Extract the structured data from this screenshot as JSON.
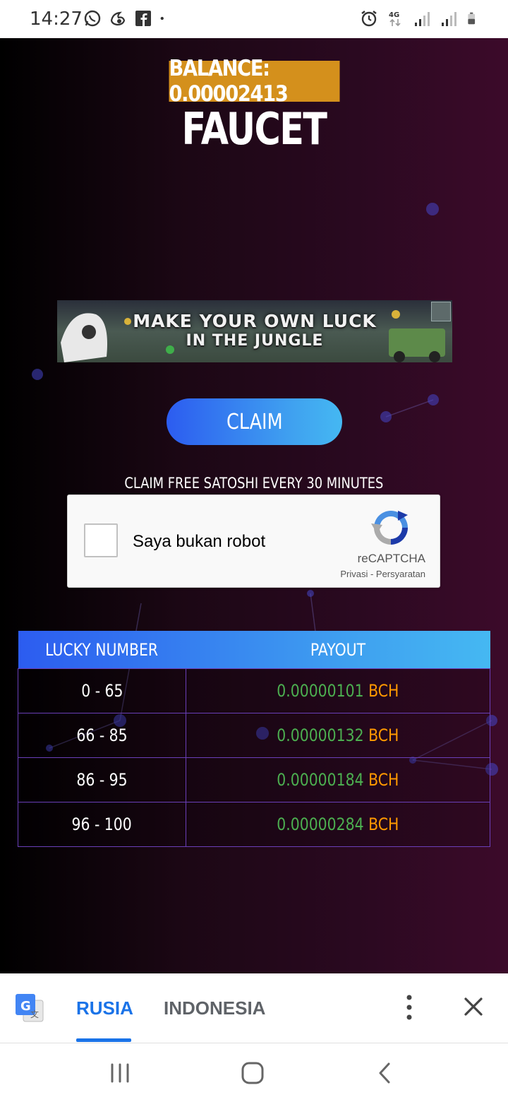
{
  "status_bar": {
    "time": "14:27",
    "left_icons": [
      "whatsapp-icon",
      "uc-browser-icon",
      "facebook-icon",
      "dot-icon"
    ],
    "right_icons": [
      "alarm-icon",
      "4g-icon",
      "signal-icon",
      "signal-icon-2",
      "battery-icon"
    ],
    "network": "4G"
  },
  "page": {
    "balance": "BALANCE: 0.00002413",
    "title": "FAUCET",
    "ad": {
      "line1": "MAKE YOUR OWN LUCK",
      "line2": "IN THE JUNGLE"
    },
    "claim_button": "CLAIM",
    "claim_note": "CLAIM FREE SATOSHI EVERY 30 MINUTES",
    "recaptcha": {
      "label": "Saya bukan robot",
      "brand": "reCAPTCHA",
      "links": "Privasi - Persyaratan"
    },
    "table": {
      "headers": [
        "LUCKY NUMBER",
        "PAYOUT"
      ],
      "rows": [
        {
          "range": "0 - 65",
          "amount": "0.00000101",
          "currency": "BCH"
        },
        {
          "range": "66 - 85",
          "amount": "0.00000132",
          "currency": "BCH"
        },
        {
          "range": "86 - 95",
          "amount": "0.00000184",
          "currency": "BCH"
        },
        {
          "range": "96 - 100",
          "amount": "0.00000284",
          "currency": "BCH"
        }
      ]
    }
  },
  "translate_bar": {
    "source_lang": "RUSIA",
    "target_lang": "INDONESIA"
  },
  "colors": {
    "balance_bg": "#d4901c",
    "accent_blue": "#1a73e8",
    "amount_green": "#4caf50",
    "currency_orange": "#ff9800",
    "table_border": "#6a3fb8"
  }
}
